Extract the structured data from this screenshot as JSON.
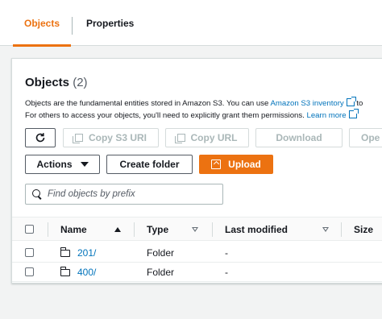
{
  "tabs": [
    {
      "label": "Objects",
      "active": true
    },
    {
      "label": "Properties",
      "active": false
    }
  ],
  "panel": {
    "title": "Objects",
    "count": "(2)",
    "description_line1_prefix": "Objects are the fundamental entities stored in Amazon S3. You can use ",
    "description_line1_link": "Amazon S3 inventory",
    "description_line1_suffix": " to",
    "description_line2_prefix": "For others to access your objects, you'll need to explicitly grant them permissions. ",
    "description_line2_link": "Learn more"
  },
  "toolbar": {
    "refresh_icon": "refresh-icon",
    "copy_s3_uri": "Copy S3 URI",
    "copy_url": "Copy URL",
    "download": "Download",
    "open": "Ope",
    "actions": "Actions",
    "create_folder": "Create folder",
    "upload": "Upload"
  },
  "search": {
    "placeholder": "Find objects by prefix",
    "value": ""
  },
  "table": {
    "columns": [
      "Name",
      "Type",
      "Last modified",
      "Size"
    ],
    "sorted_column": "Name",
    "sort_direction": "ascending",
    "rows": [
      {
        "name": "201/",
        "type": "Folder",
        "last_modified": "-"
      },
      {
        "name": "400/",
        "type": "Folder",
        "last_modified": "-"
      }
    ]
  },
  "colors": {
    "accent": "#ec7211",
    "link": "#0073bb",
    "text": "#16191f",
    "muted": "#545b64",
    "page_bg": "#f2f3f3"
  }
}
